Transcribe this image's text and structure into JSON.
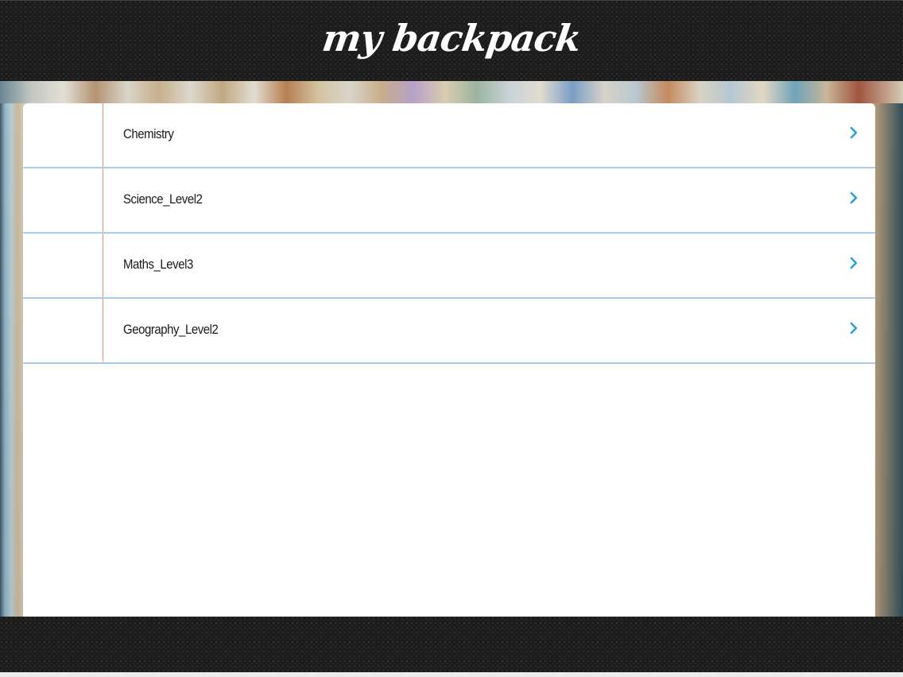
{
  "header": {
    "title": "my backpack"
  },
  "list": {
    "items": [
      {
        "label": "Chemistry",
        "icon": "chevron-right-icon"
      },
      {
        "label": "Science_Level2",
        "icon": "chevron-right-icon"
      },
      {
        "label": "Maths_Level3",
        "icon": "chevron-right-icon"
      },
      {
        "label": "Geography_Level2",
        "icon": "chevron-right-icon"
      }
    ]
  },
  "colors": {
    "header_bar": "#1b1b1b",
    "chevron": "#2aa3d8",
    "row_rule": "#a9cdf2",
    "margin_rule": "#ef8a8a",
    "panel": "#ffffff"
  }
}
